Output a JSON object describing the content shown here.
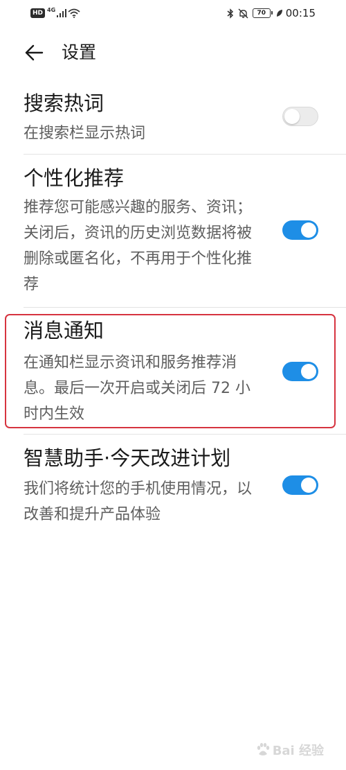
{
  "status_bar": {
    "hd_badge": "HD",
    "network": "4G",
    "battery": "70",
    "time": "00:15"
  },
  "header": {
    "back_icon": "arrow-left-icon",
    "title": "设置"
  },
  "settings": [
    {
      "title": "搜索热词",
      "description": "在搜索栏显示热词",
      "enabled": false
    },
    {
      "title": "个性化推荐",
      "description": "推荐您可能感兴趣的服务、资讯； 关闭后，资讯的历史浏览数据将被删除或匿名化，不再用于个性化推荐",
      "enabled": true
    },
    {
      "title": "消息通知",
      "description": "在通知栏显示资讯和服务推荐消息。最后一次开启或关闭后 72 小时内生效",
      "enabled": true
    },
    {
      "title": "智慧助手·今天改进计划",
      "description": "我们将统计您的手机使用情况，以改善和提升产品体验",
      "enabled": true
    }
  ],
  "colors": {
    "toggle_on": "#1e8ee6",
    "toggle_off": "#ececec",
    "highlight": "#d6333f"
  },
  "watermark": {
    "text": "Bai 经验"
  }
}
